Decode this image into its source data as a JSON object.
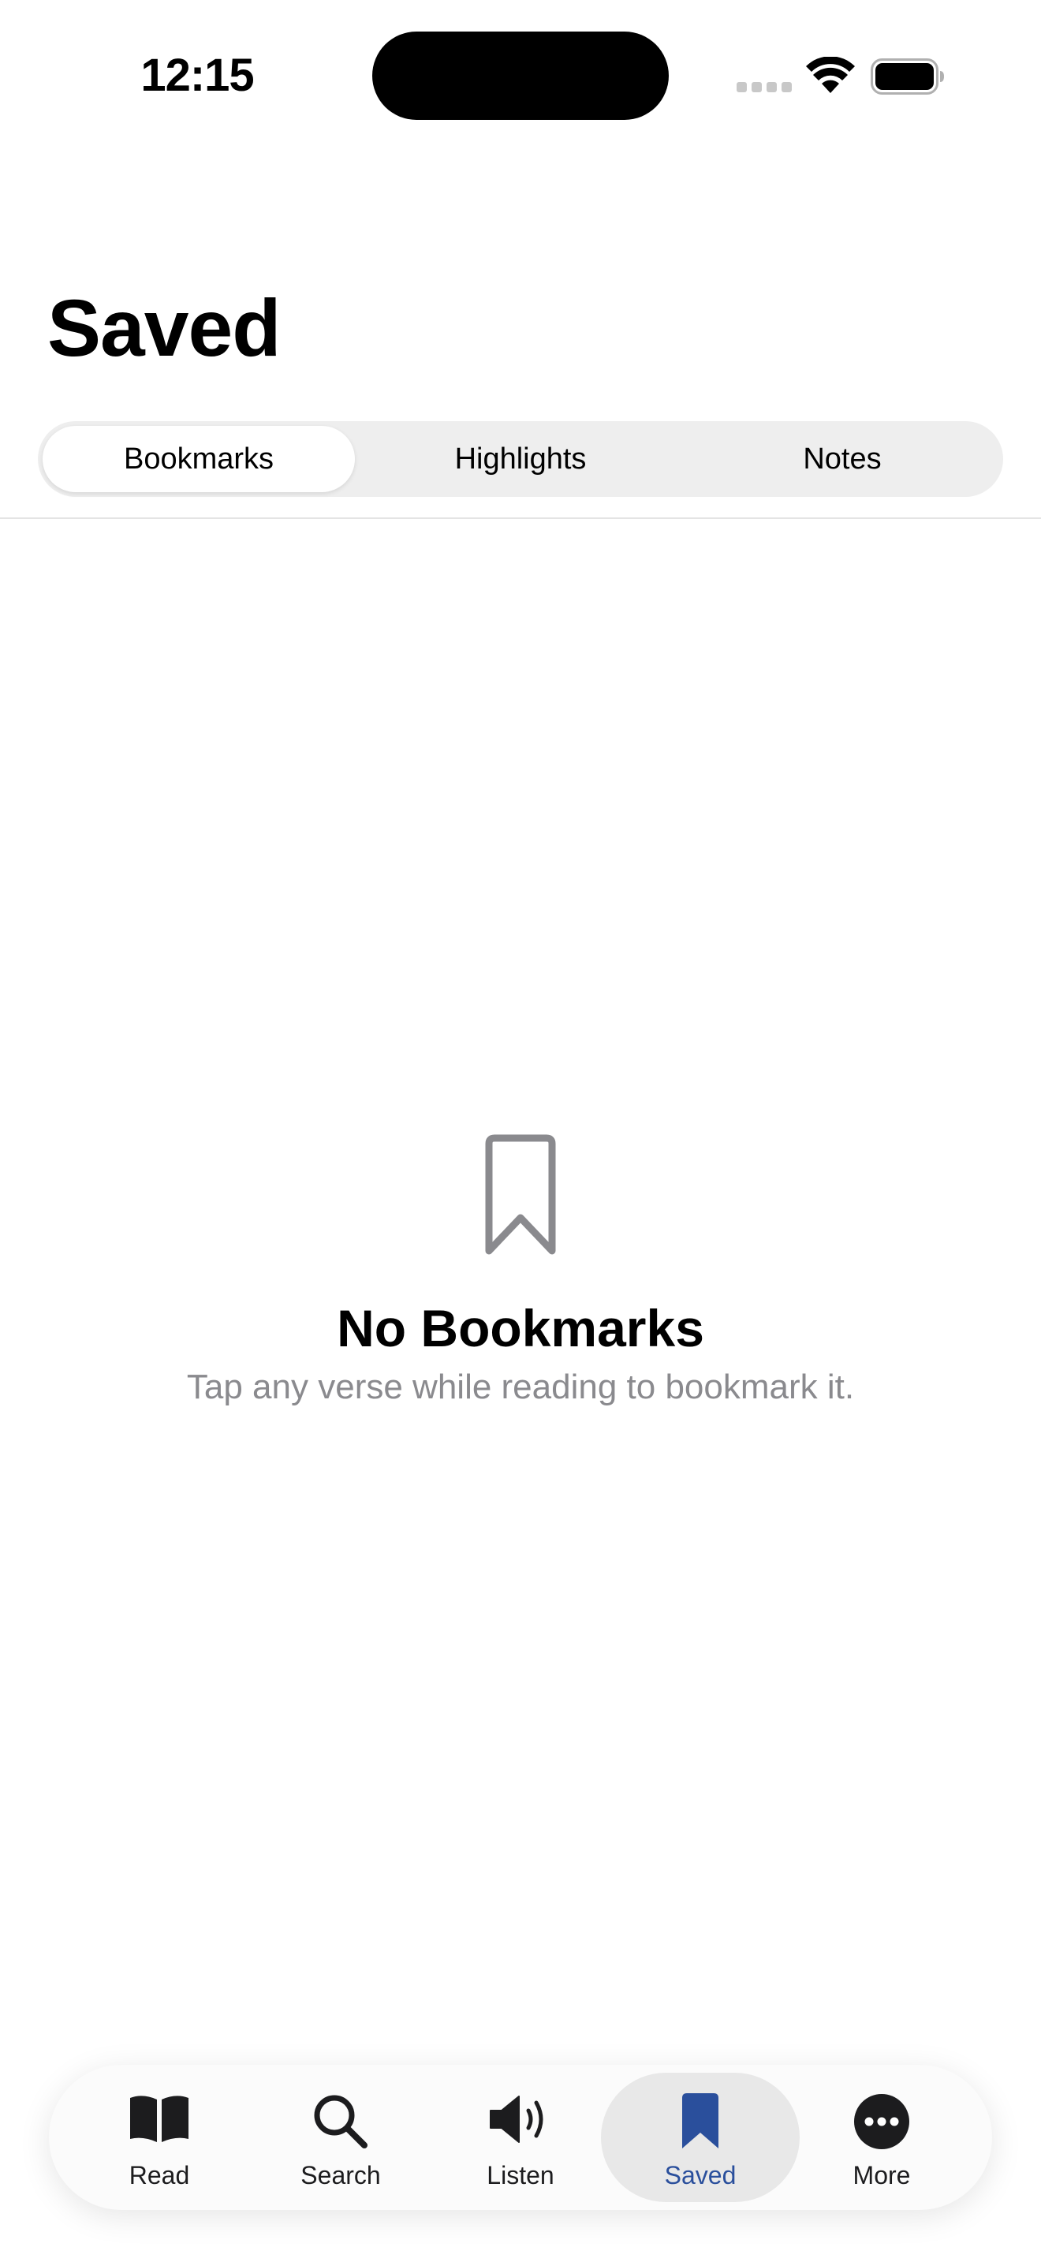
{
  "status_bar": {
    "time": "12:15"
  },
  "header": {
    "title": "Saved"
  },
  "segments": [
    {
      "label": "Bookmarks",
      "selected": true
    },
    {
      "label": "Highlights",
      "selected": false
    },
    {
      "label": "Notes",
      "selected": false
    }
  ],
  "empty_state": {
    "icon": "bookmark-outline-icon",
    "title": "No Bookmarks",
    "subtitle": "Tap any verse while reading to bookmark it."
  },
  "tab_bar": {
    "items": [
      {
        "label": "Read",
        "icon": "open-book-icon",
        "selected": false
      },
      {
        "label": "Search",
        "icon": "magnifier-icon",
        "selected": false
      },
      {
        "label": "Listen",
        "icon": "speaker-icon",
        "selected": false
      },
      {
        "label": "Saved",
        "icon": "bookmark-icon",
        "selected": true
      },
      {
        "label": "More",
        "icon": "ellipsis-circle-icon",
        "selected": false
      }
    ],
    "active_color": "#2a4f9c"
  },
  "colors": {
    "accent": "#2a4f9c",
    "secondary_text": "#8a8a8e",
    "segment_bg": "#eeeeee"
  }
}
